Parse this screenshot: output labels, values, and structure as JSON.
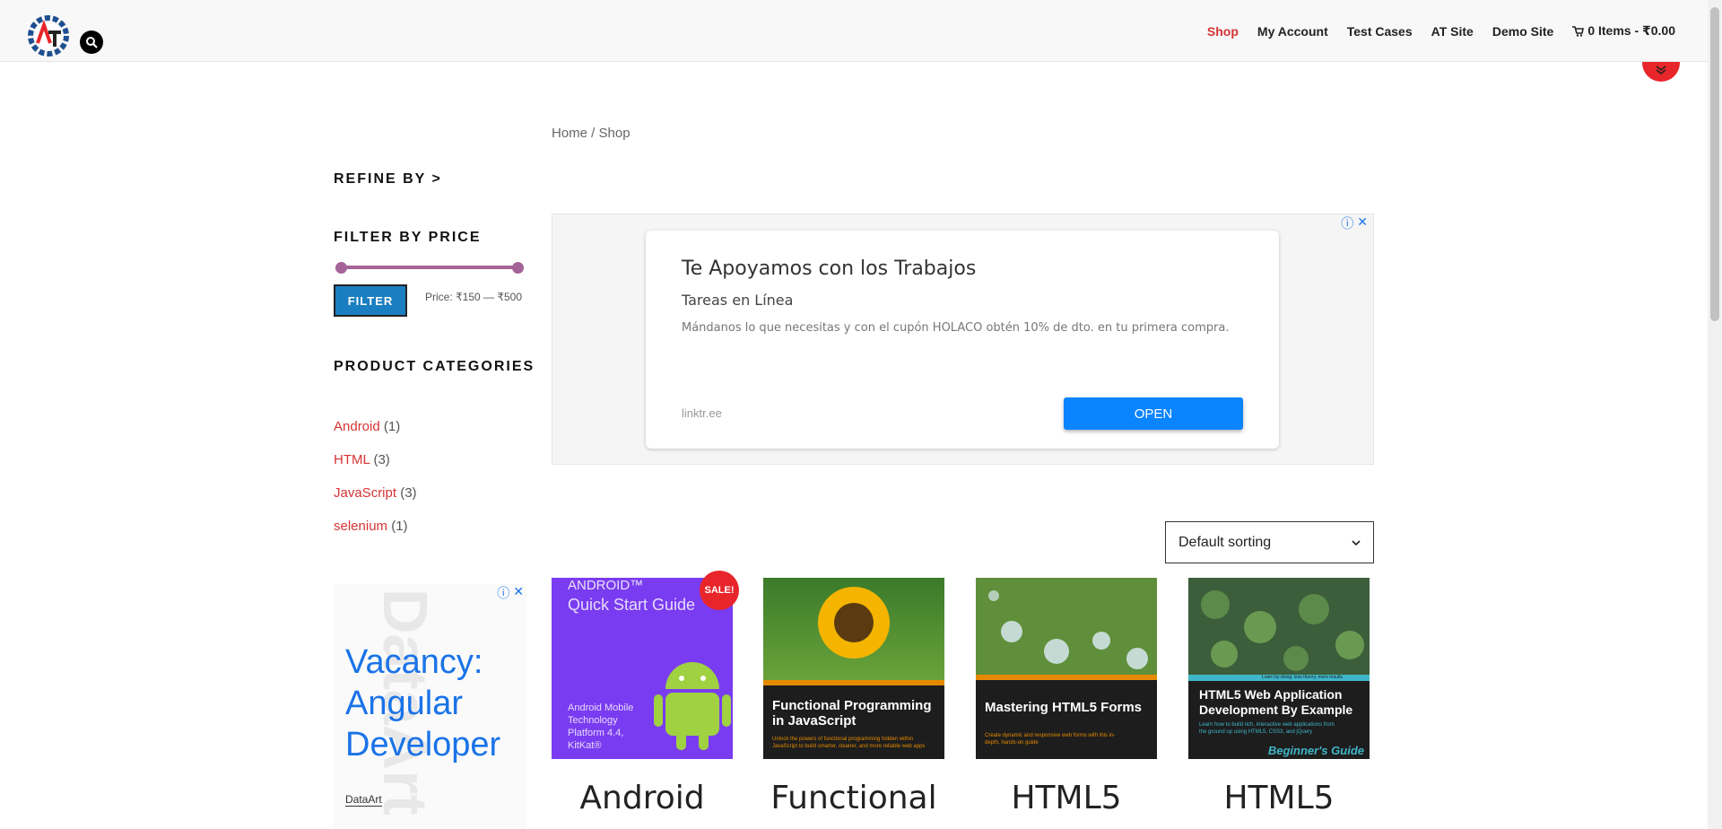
{
  "header": {
    "nav": [
      {
        "label": "Shop",
        "active": true
      },
      {
        "label": "My Account",
        "active": false
      },
      {
        "label": "Test Cases",
        "active": false
      },
      {
        "label": "AT Site",
        "active": false
      },
      {
        "label": "Demo Site",
        "active": false
      }
    ],
    "cart_label": "0 Items - ₹0.00"
  },
  "breadcrumb": "Home / Shop",
  "sidebar": {
    "refine_title": "REFINE BY >",
    "filter_price_title": "FILTER BY PRICE",
    "filter_button": "FILTER",
    "price_range": "Price: ₹150 — ₹500",
    "categories_title": "PRODUCT CATEGORIES",
    "categories": [
      {
        "name": "Android",
        "count": "(1)"
      },
      {
        "name": "HTML",
        "count": "(3)"
      },
      {
        "name": "JavaScript",
        "count": "(3)"
      },
      {
        "name": "selenium",
        "count": "(1)"
      }
    ],
    "ad": {
      "headline": "Vacancy: Angular Developer",
      "brand": "DataArt",
      "bg_text": "DataArt"
    }
  },
  "main_ad": {
    "title": "Te Apoyamos con los Trabajos",
    "subtitle": "Tareas en Línea",
    "description": "Mándanos lo que necesitas y con el cupón HOLACO obtén 10% de dto. en tu primera compra.",
    "domain": "linktr.ee",
    "button": "OPEN"
  },
  "sorting": "Default sorting",
  "products": [
    {
      "title": "Android",
      "sale": "SALE!",
      "cover_top": "ANDROID™",
      "cover_sub": "Quick Start Guide",
      "cover_note": "Android Mobile Technology Platform 4.4, KitKat®"
    },
    {
      "title": "Functional",
      "cover_text": "Functional Programming in JavaScript",
      "cover_small": "Unlock the powers of functional programming hidden within JavaScript to build smarter, cleaner, and more reliable web apps"
    },
    {
      "title": "HTML5",
      "cover_text": "Mastering HTML5 Forms",
      "cover_small": "Create dynamic and responsive web forms with this in-depth, hands-on guide"
    },
    {
      "title": "HTML5",
      "cover_text": "HTML5 Web Application Development By Example",
      "cover_small": "Learn how to build rich, interactive web applications from the ground up using HTML5, CSS3, and jQuery",
      "cover_tag": "Beginner's Guide",
      "cover_band": "Learn by doing: less theory, more results"
    }
  ],
  "colors": {
    "accent": "#d63333",
    "filter_button": "#1a7fc1",
    "slider": "#a46497",
    "ad_button": "#0a84ff",
    "sale_badge": "#e8252a"
  }
}
